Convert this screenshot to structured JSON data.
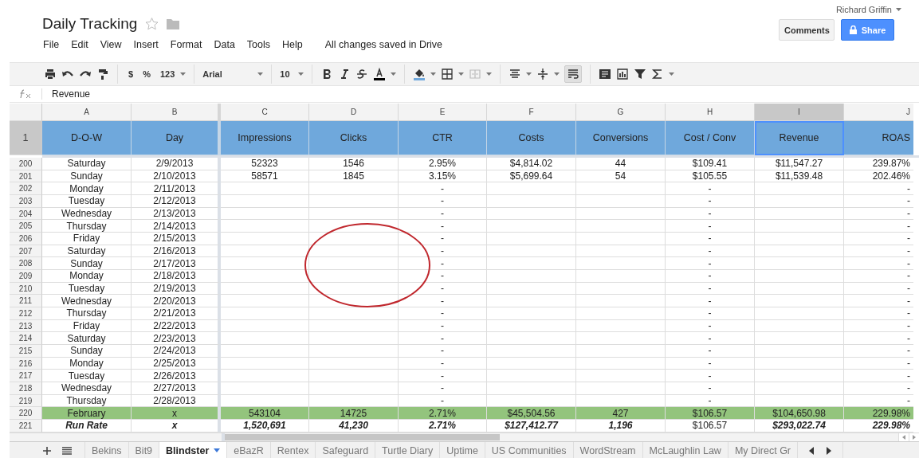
{
  "document": {
    "title": "Daily Tracking",
    "starred": false,
    "status": "All changes saved in Drive"
  },
  "user": {
    "name": "Richard Griffin"
  },
  "buttons": {
    "comments": "Comments",
    "share": "Share"
  },
  "menu": [
    "File",
    "Edit",
    "View",
    "Insert",
    "Format",
    "Data",
    "Tools",
    "Help"
  ],
  "toolbar": {
    "currency": "$",
    "percent": "%",
    "number_format": "123",
    "font": "Arial",
    "font_size": "10",
    "wrap_selected": true
  },
  "formula_bar": {
    "value": "Revenue"
  },
  "columns": [
    {
      "letter": "A",
      "header": "D-O-W",
      "selected": false
    },
    {
      "letter": "B",
      "header": "Day",
      "selected": false
    },
    {
      "letter": "C",
      "header": "Impressions",
      "selected": false
    },
    {
      "letter": "D",
      "header": "Clicks",
      "selected": false
    },
    {
      "letter": "E",
      "header": "CTR",
      "selected": false
    },
    {
      "letter": "F",
      "header": "Costs",
      "selected": false
    },
    {
      "letter": "G",
      "header": "Conversions",
      "selected": false
    },
    {
      "letter": "H",
      "header": "Cost / Conv",
      "selected": false
    },
    {
      "letter": "I",
      "header": "Revenue",
      "selected": true
    },
    {
      "letter": "J",
      "header": "ROAS",
      "selected": false
    }
  ],
  "header_row": "1",
  "rows": [
    {
      "number": "200",
      "kind": "data",
      "cells": {
        "A": "Saturday",
        "B": "2/9/2013",
        "C": "52323",
        "D": "1546",
        "E": "2.95%",
        "F": "$4,814.02",
        "G": "44",
        "H": "$109.41",
        "I": "$11,547.27",
        "J": "239.87%"
      }
    },
    {
      "number": "201",
      "kind": "data",
      "cells": {
        "A": "Sunday",
        "B": "2/10/2013",
        "C": "58571",
        "D": "1845",
        "E": "3.15%",
        "F": "$5,699.64",
        "G": "54",
        "H": "$105.55",
        "I": "$11,539.48",
        "J": "202.46%"
      }
    },
    {
      "number": "202",
      "kind": "data",
      "cells": {
        "A": "Monday",
        "B": "2/11/2013",
        "E": "-",
        "H": "-",
        "J": "-"
      }
    },
    {
      "number": "203",
      "kind": "data",
      "cells": {
        "A": "Tuesday",
        "B": "2/12/2013",
        "E": "-",
        "H": "-",
        "J": "-"
      }
    },
    {
      "number": "204",
      "kind": "data",
      "cells": {
        "A": "Wednesday",
        "B": "2/13/2013",
        "E": "-",
        "H": "-",
        "J": "-"
      }
    },
    {
      "number": "205",
      "kind": "data",
      "cells": {
        "A": "Thursday",
        "B": "2/14/2013",
        "E": "-",
        "H": "-",
        "J": "-"
      }
    },
    {
      "number": "206",
      "kind": "data",
      "cells": {
        "A": "Friday",
        "B": "2/15/2013",
        "E": "-",
        "H": "-",
        "J": "-"
      }
    },
    {
      "number": "207",
      "kind": "data",
      "cells": {
        "A": "Saturday",
        "B": "2/16/2013",
        "E": "-",
        "H": "-",
        "J": "-"
      }
    },
    {
      "number": "208",
      "kind": "data",
      "cells": {
        "A": "Sunday",
        "B": "2/17/2013",
        "E": "-",
        "H": "-",
        "J": "-"
      }
    },
    {
      "number": "209",
      "kind": "data",
      "cells": {
        "A": "Monday",
        "B": "2/18/2013",
        "E": "-",
        "H": "-",
        "J": "-"
      }
    },
    {
      "number": "210",
      "kind": "data",
      "cells": {
        "A": "Tuesday",
        "B": "2/19/2013",
        "E": "-",
        "H": "-",
        "J": "-"
      }
    },
    {
      "number": "211",
      "kind": "data",
      "cells": {
        "A": "Wednesday",
        "B": "2/20/2013",
        "E": "-",
        "H": "-",
        "J": "-"
      }
    },
    {
      "number": "212",
      "kind": "data",
      "cells": {
        "A": "Thursday",
        "B": "2/21/2013",
        "E": "-",
        "H": "-",
        "J": "-"
      }
    },
    {
      "number": "213",
      "kind": "data",
      "cells": {
        "A": "Friday",
        "B": "2/22/2013",
        "E": "-",
        "H": "-",
        "J": "-"
      }
    },
    {
      "number": "214",
      "kind": "data",
      "cells": {
        "A": "Saturday",
        "B": "2/23/2013",
        "E": "-",
        "H": "-",
        "J": "-"
      }
    },
    {
      "number": "215",
      "kind": "data",
      "cells": {
        "A": "Sunday",
        "B": "2/24/2013",
        "E": "-",
        "H": "-",
        "J": "-"
      }
    },
    {
      "number": "216",
      "kind": "data",
      "cells": {
        "A": "Monday",
        "B": "2/25/2013",
        "E": "-",
        "H": "-",
        "J": "-"
      }
    },
    {
      "number": "217",
      "kind": "data",
      "cells": {
        "A": "Tuesday",
        "B": "2/26/2013",
        "E": "-",
        "H": "-",
        "J": "-"
      }
    },
    {
      "number": "218",
      "kind": "data",
      "cells": {
        "A": "Wednesday",
        "B": "2/27/2013",
        "E": "-",
        "H": "-",
        "J": "-"
      }
    },
    {
      "number": "219",
      "kind": "data",
      "cells": {
        "A": "Thursday",
        "B": "2/28/2013",
        "E": "-",
        "H": "-",
        "J": "-"
      }
    },
    {
      "number": "220",
      "kind": "total",
      "cells": {
        "A": "February",
        "B": "x",
        "C": "543104",
        "D": "14725",
        "E": "2.71%",
        "F": "$45,504.56",
        "G": "427",
        "H": "$106.57",
        "I": "$104,650.98",
        "J": "229.98%"
      }
    },
    {
      "number": "221",
      "kind": "run_rate",
      "cells": {
        "A": {
          "text": "Run Rate",
          "emphasized": true
        },
        "B": {
          "text": "x",
          "emphasized": true
        },
        "C": {
          "text": "1,520,691",
          "emphasized": true
        },
        "D": {
          "text": "41,230",
          "emphasized": true
        },
        "E": {
          "text": "2.71%",
          "emphasized": true
        },
        "F": {
          "text": "$127,412.77",
          "emphasized": true
        },
        "G": {
          "text": "1,196",
          "emphasized": true
        },
        "H": {
          "text": "$106.57",
          "emphasized": false
        },
        "I": {
          "text": "$293,022.74",
          "emphasized": true
        },
        "J": {
          "text": "229.98%",
          "emphasized": true
        }
      }
    }
  ],
  "sheet_tabs": [
    {
      "label": "Bekins",
      "selected": false
    },
    {
      "label": "Bit9",
      "selected": false
    },
    {
      "label": "Blindster",
      "selected": true
    },
    {
      "label": "eBazR",
      "selected": false
    },
    {
      "label": "Rentex",
      "selected": false
    },
    {
      "label": "Safeguard",
      "selected": false
    },
    {
      "label": "Turtle Diary",
      "selected": false
    },
    {
      "label": "Uptime",
      "selected": false
    },
    {
      "label": "US Communities",
      "selected": false
    },
    {
      "label": "WordStream",
      "selected": false
    },
    {
      "label": "McLaughlin Law",
      "selected": false
    },
    {
      "label": "My Direct Gr",
      "selected": false
    }
  ]
}
